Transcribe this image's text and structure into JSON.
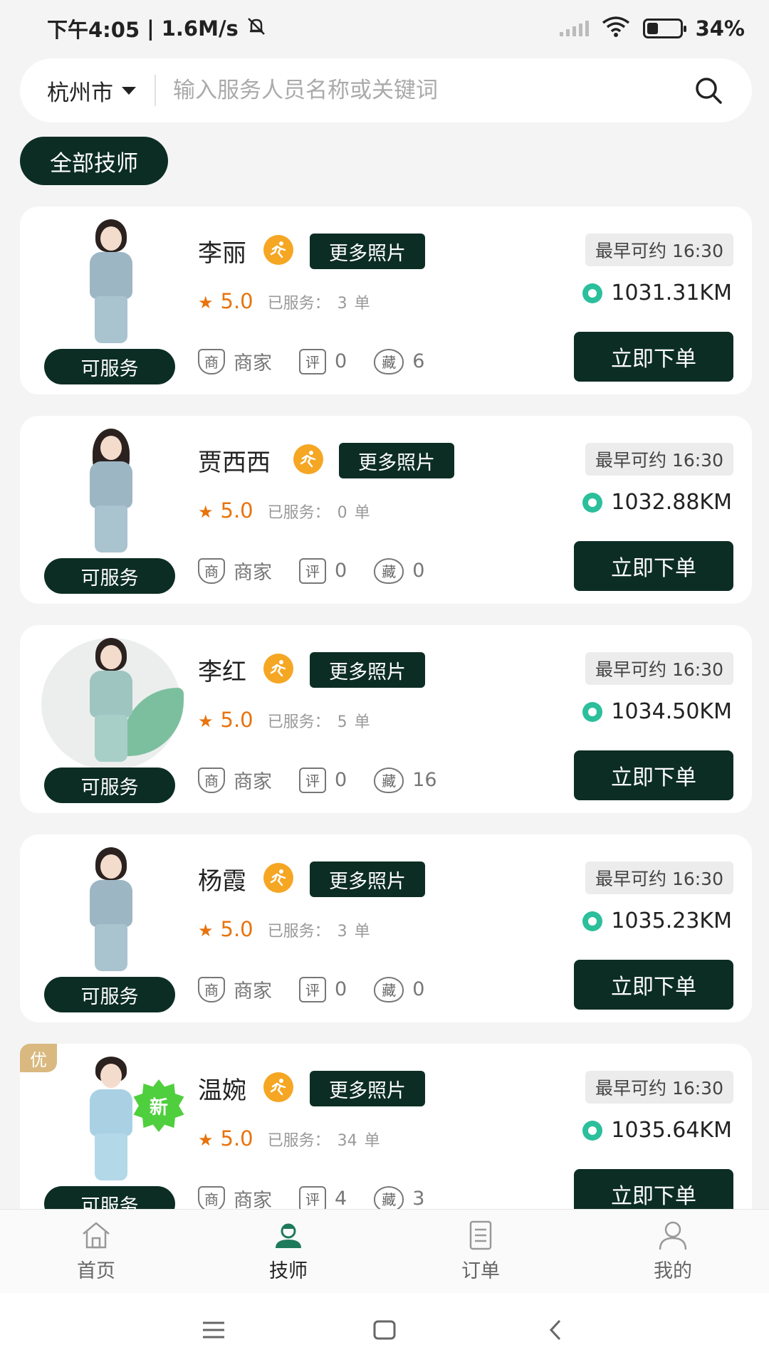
{
  "status_bar": {
    "time": "下午4:05",
    "speed": "1.6M/s",
    "battery_level": 34,
    "battery_text": "34%"
  },
  "search": {
    "city": "杭州市",
    "placeholder": "输入服务人员名称或关键词"
  },
  "filter": {
    "label": "全部技师"
  },
  "card_labels": {
    "more_photos": "更多照片",
    "served_label": "已服务：",
    "served_unit": "单",
    "merchant": "商家",
    "order_button": "立即下单",
    "status": "可服务",
    "comment_icon_text": "评",
    "favorite_icon_text": "藏",
    "merchant_icon_text": "商"
  },
  "technicians": [
    {
      "name": "李丽",
      "rating": "5.0",
      "served": "3",
      "comments": "0",
      "favorites": "6",
      "appointment": "最早可约 16:30",
      "distance": "1031.31KM"
    },
    {
      "name": "贾西西",
      "rating": "5.0",
      "served": "0",
      "comments": "0",
      "favorites": "0",
      "appointment": "最早可约 16:30",
      "distance": "1032.88KM"
    },
    {
      "name": "李红",
      "rating": "5.0",
      "served": "5",
      "comments": "0",
      "favorites": "16",
      "appointment": "最早可约 16:30",
      "distance": "1034.50KM"
    },
    {
      "name": "杨霞",
      "rating": "5.0",
      "served": "3",
      "comments": "0",
      "favorites": "0",
      "appointment": "最早可约 16:30",
      "distance": "1035.23KM"
    },
    {
      "name": "温婉",
      "rating": "5.0",
      "served": "34",
      "comments": "4",
      "favorites": "3",
      "appointment": "最早可约 16:30",
      "distance": "1035.64KM",
      "corner_tag": "优",
      "new_badge": "新"
    }
  ],
  "tab_bar": {
    "tabs": [
      {
        "label": "首页",
        "icon": "home-icon"
      },
      {
        "label": "技师",
        "icon": "technician-icon",
        "active": true
      },
      {
        "label": "订单",
        "icon": "order-icon"
      },
      {
        "label": "我的",
        "icon": "profile-icon"
      }
    ]
  },
  "colors": {
    "primary": "#0c2d24",
    "accent_orange": "#e8730c",
    "location_green": "#2bbf9b",
    "badge_green": "#4fcf3e",
    "tag_gold": "#d9b980"
  }
}
